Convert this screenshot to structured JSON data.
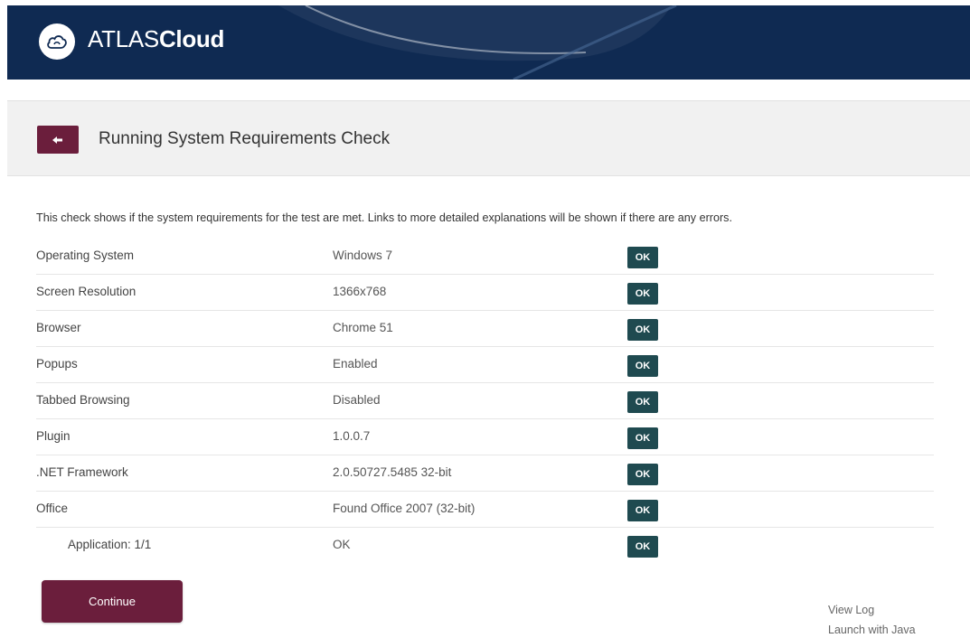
{
  "brand": {
    "light": "ATLAS",
    "bold": "Cloud",
    "icon": "cloud-logo-icon"
  },
  "page": {
    "title": "Running System Requirements Check",
    "back_icon": "arrow-left-icon"
  },
  "intro": "This check shows if the system requirements for the test are met. Links to more detailed explanations will be shown if there are any errors.",
  "checks": [
    {
      "name": "Operating System",
      "value": "Windows 7",
      "status": "OK"
    },
    {
      "name": "Screen Resolution",
      "value": "1366x768",
      "status": "OK"
    },
    {
      "name": "Browser",
      "value": "Chrome 51",
      "status": "OK"
    },
    {
      "name": "Popups",
      "value": "Enabled",
      "status": "OK"
    },
    {
      "name": "Tabbed Browsing",
      "value": "Disabled",
      "status": "OK"
    },
    {
      "name": "Plugin",
      "value": "1.0.0.7",
      "status": "OK"
    },
    {
      "name": ".NET Framework",
      "value": "2.0.50727.5485 32-bit",
      "status": "OK"
    },
    {
      "name": "Office",
      "value": "Found Office 2007 (32-bit)",
      "status": "OK"
    },
    {
      "name": "Application: 1/1",
      "value": "OK",
      "status": "OK"
    }
  ],
  "actions": {
    "continue": "Continue",
    "view_log": "View Log",
    "launch_java": "Launch with Java"
  },
  "colors": {
    "header_bg": "#0f2a52",
    "accent": "#6b1e3c",
    "badge": "#1f4a50"
  }
}
